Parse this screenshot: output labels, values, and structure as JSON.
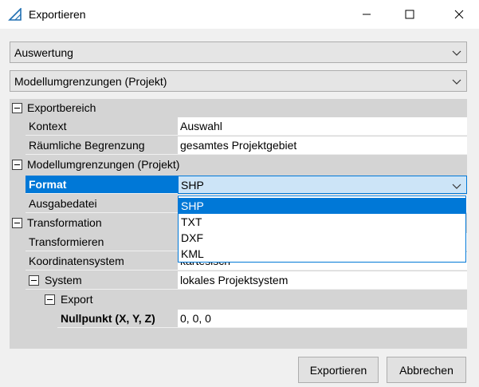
{
  "window": {
    "title": "Exportieren",
    "icon": "triangle-ruler-icon",
    "controls": [
      "minimize-icon",
      "maximize-icon",
      "close-icon"
    ]
  },
  "combos": {
    "first": "Auswertung",
    "second": "Modellumgrenzungen (Projekt)"
  },
  "grid": {
    "cat_export": "Exportbereich",
    "kontext": {
      "name": "Kontext",
      "value": "Auswahl"
    },
    "raum": {
      "name": "Räumliche Begrenzung",
      "value": "gesamtes Projektgebiet"
    },
    "cat_modell": "Modellumgrenzungen (Projekt)",
    "format": {
      "name": "Format",
      "value": "SHP"
    },
    "ausgabe": {
      "name": "Ausgabedatei"
    },
    "cat_trans": "Transformation",
    "transformieren": {
      "name": "Transformieren"
    },
    "koord": {
      "name": "Koordinatensystem",
      "value": "kartesisch"
    },
    "system": {
      "name": "System",
      "value": "lokales Projektsystem"
    },
    "export_sub": "Export",
    "nullpunkt": {
      "name": "Nullpunkt (X, Y, Z)",
      "value": "0, 0, 0"
    }
  },
  "dropdown": {
    "options": [
      "SHP",
      "TXT",
      "DXF",
      "KML"
    ],
    "highlighted": "SHP"
  },
  "buttons": {
    "export": "Exportieren",
    "cancel": "Abbrechen"
  },
  "colors": {
    "accent": "#0078d7",
    "selection_light": "#cce4f7",
    "category_bg": "#d4d4d4"
  }
}
